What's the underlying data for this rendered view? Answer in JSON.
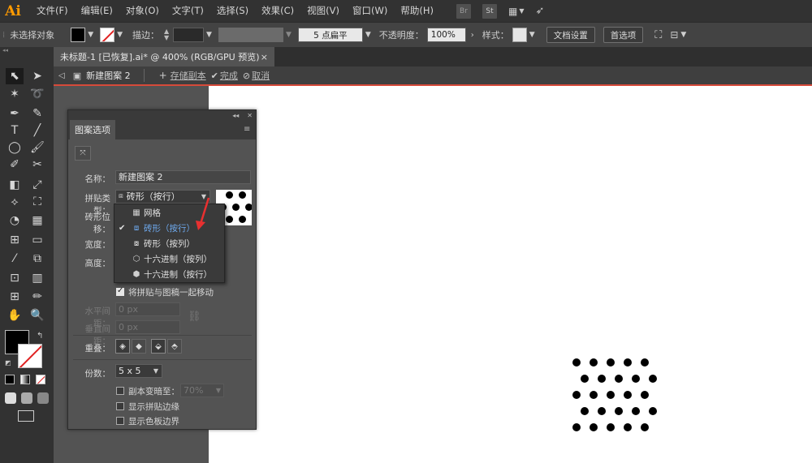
{
  "app": {
    "logo": "Ai"
  },
  "menu": [
    "文件(F)",
    "编辑(E)",
    "对象(O)",
    "文字(T)",
    "选择(S)",
    "效果(C)",
    "视图(V)",
    "窗口(W)",
    "帮助(H)"
  ],
  "menu_extras": {
    "bridge": "Br",
    "stock": "St"
  },
  "control_bar": {
    "selection_status": "未选择对象",
    "stroke_label": "描边：",
    "brush_label": "5 点扁平",
    "opacity_label": "不透明度：",
    "opacity_value": "100%",
    "style_label": "样式：",
    "doc_settings": "文档设置",
    "preferences": "首选项"
  },
  "document_tab": {
    "title": "未标题-1 [已恢复].ai* @ 400% (RGB/GPU 预览)",
    "close": "×"
  },
  "isolation_bar": {
    "pattern_name": "新建图案 2",
    "save_copy": "存储副本",
    "done": "完成",
    "cancel": "取消"
  },
  "panel": {
    "title": "图案选项",
    "name_label": "名称：",
    "name_value": "新建图案 2",
    "tile_type_label": "拼贴类型：",
    "tile_type_value": "砖形（按行）",
    "brick_offset_label": "砖形位移：",
    "width_label": "宽度：",
    "height_label": "高度：",
    "move_tile_label": "将拼贴与图稿一起移动",
    "move_tile_checked": true,
    "h_spacing_label": "水平间距：",
    "h_spacing_value": "0 px",
    "v_spacing_label": "垂直间距：",
    "v_spacing_value": "0 px",
    "overlap_label": "重叠：",
    "copies_label": "份数：",
    "copies_value": "5 x 5",
    "dim_copies_label": "副本变暗至：",
    "dim_copies_value": "70%",
    "show_tile_edge_label": "显示拼贴边缘",
    "show_swatch_bounds_label": "显示色板边界"
  },
  "dropdown": {
    "items": [
      {
        "icon": "grid-icon",
        "label": "网格",
        "selected": false
      },
      {
        "icon": "brick-row-icon",
        "label": "砖形（按行）",
        "selected": true
      },
      {
        "icon": "brick-column-icon",
        "label": "砖形（按列）",
        "selected": false
      },
      {
        "icon": "hex-column-icon",
        "label": "十六进制（按列）",
        "selected": false
      },
      {
        "icon": "hex-row-icon",
        "label": "十六进制（按行）",
        "selected": false
      }
    ]
  },
  "colors": {
    "accent_red": "#d64a3a",
    "selected_blue": "#6ea9ee",
    "logo_orange": "#ff9a00"
  }
}
